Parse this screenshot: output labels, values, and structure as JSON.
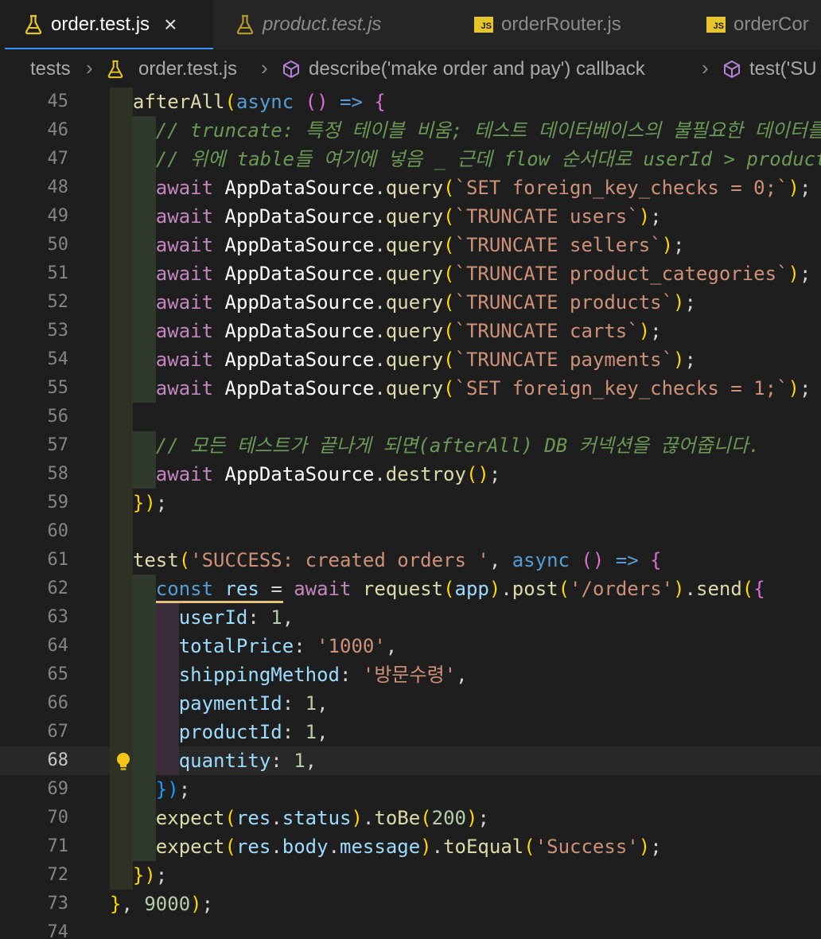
{
  "tabs": [
    {
      "label": "order.test.js",
      "icon": "flask-icon",
      "active": true,
      "close": "×"
    },
    {
      "label": "product.test.js",
      "icon": "flask-icon",
      "active": false,
      "preview": true
    },
    {
      "label": "orderRouter.js",
      "icon": "js-file-icon",
      "badge": "JS",
      "active": false
    },
    {
      "label": "orderCor",
      "icon": "js-file-icon",
      "badge": "JS",
      "active": false
    }
  ],
  "breadcrumb": {
    "items": [
      "tests",
      "order.test.js",
      "describe('make order and pay') callback",
      "test('SU"
    ],
    "separator": "›"
  },
  "editor": {
    "current_line": 68,
    "lines": [
      {
        "n": "45",
        "text": "afterAll(async () => {"
      },
      {
        "n": "46",
        "text": "// truncate: 특정 테이블 비움; 테스트 데이터베이스의 불필요한 데이터를 전"
      },
      {
        "n": "47",
        "text": "// 위에 table들 여기에 넣음 _ 근데 flow 순서대로 userId > productI"
      },
      {
        "n": "48",
        "text": "await AppDataSource.query(`SET foreign_key_checks = 0;`);"
      },
      {
        "n": "49",
        "text": "await AppDataSource.query(`TRUNCATE users`);"
      },
      {
        "n": "50",
        "text": "await AppDataSource.query(`TRUNCATE sellers`);"
      },
      {
        "n": "51",
        "text": "await AppDataSource.query(`TRUNCATE product_categories`);"
      },
      {
        "n": "52",
        "text": "await AppDataSource.query(`TRUNCATE products`);"
      },
      {
        "n": "53",
        "text": "await AppDataSource.query(`TRUNCATE carts`);"
      },
      {
        "n": "54",
        "text": "await AppDataSource.query(`TRUNCATE payments`);"
      },
      {
        "n": "55",
        "text": "await AppDataSource.query(`SET foreign_key_checks = 1;`);"
      },
      {
        "n": "56",
        "text": ""
      },
      {
        "n": "57",
        "text": "// 모든 테스트가 끝나게 되면(afterAll) DB 커넥션을 끊어줍니다."
      },
      {
        "n": "58",
        "text": "await AppDataSource.destroy();"
      },
      {
        "n": "59",
        "text": "});"
      },
      {
        "n": "60",
        "text": ""
      },
      {
        "n": "61",
        "text": "test('SUCCESS: created orders ', async () => {"
      },
      {
        "n": "62",
        "text": "const res = await request(app).post('/orders').send({"
      },
      {
        "n": "63",
        "text": "userId: 1,"
      },
      {
        "n": "64",
        "text": "totalPrice: '1000',"
      },
      {
        "n": "65",
        "text": "shippingMethod: '방문수령',"
      },
      {
        "n": "66",
        "text": "paymentId: 1,"
      },
      {
        "n": "67",
        "text": "productId: 1,"
      },
      {
        "n": "68",
        "text": "quantity: 1,"
      },
      {
        "n": "69",
        "text": "});"
      },
      {
        "n": "70",
        "text": "expect(res.status).toBe(200);"
      },
      {
        "n": "71",
        "text": "expect(res.body.message).toEqual('Success');"
      },
      {
        "n": "72",
        "text": "});"
      },
      {
        "n": "73",
        "text": "}, 9000);"
      },
      {
        "n": "74",
        "text": ""
      }
    ]
  },
  "colors": {
    "background": "#1e1e1e",
    "keyword": "#c586c0",
    "storage": "#569cd6",
    "function": "#dcdcaa",
    "variable": "#9cdcfe",
    "string": "#ce9178",
    "number": "#b5cea8",
    "comment": "#6a9955",
    "bracket_gold": "#ffd700",
    "bracket_pink": "#da70d6",
    "bracket_blue": "#179fff",
    "active_tab_underline": "#3794ff"
  }
}
